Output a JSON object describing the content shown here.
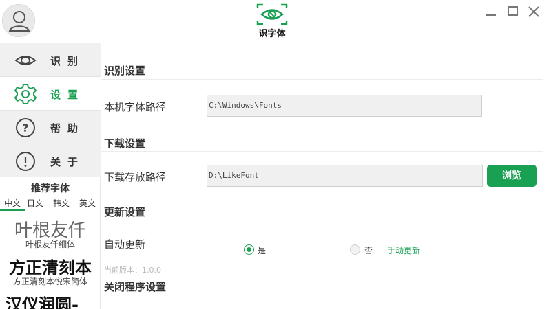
{
  "app": {
    "name": "识字体",
    "accent_color": "#1aa053"
  },
  "titlebar": {
    "minimize_icon": "minimize-icon",
    "maximize_icon": "maximize-icon",
    "close_icon": "close-icon"
  },
  "sidebar": {
    "nav": [
      {
        "label": "识别",
        "icon": "eye-icon",
        "active": false
      },
      {
        "label": "设置",
        "icon": "gear-icon",
        "active": true
      },
      {
        "label": "帮助",
        "icon": "question-icon",
        "active": false
      },
      {
        "label": "关于",
        "icon": "exclamation-icon",
        "active": false
      }
    ],
    "recommend_title": "推荐字体",
    "lang_tabs": [
      {
        "label": "中文",
        "active": true
      },
      {
        "label": "日文",
        "active": false
      },
      {
        "label": "韩文",
        "active": false
      },
      {
        "label": "英文",
        "active": false
      }
    ],
    "fonts": [
      {
        "sample": "叶根友仟",
        "name": "叶根友仟细体"
      },
      {
        "sample": "方正清刻本",
        "name": "方正清刻本悦宋简体"
      },
      {
        "sample": "汉仪润圆-",
        "name": ""
      }
    ]
  },
  "settings": {
    "recognition": {
      "title": "识别设置",
      "font_path_label": "本机字体路径",
      "font_path_value": "C:\\Windows\\Fonts"
    },
    "download": {
      "title": "下载设置",
      "save_path_label": "下载存放路径",
      "save_path_value": "D:\\LikeFont",
      "browse_label": "浏览"
    },
    "update": {
      "title": "更新设置",
      "auto_update_label": "自动更新",
      "yes_label": "是",
      "no_label": "否",
      "manual_update_label": "手动更新",
      "version_text": "当前版本：1.0.0",
      "auto_update_selected": "是"
    },
    "close": {
      "title": "关闭程序设置"
    }
  }
}
